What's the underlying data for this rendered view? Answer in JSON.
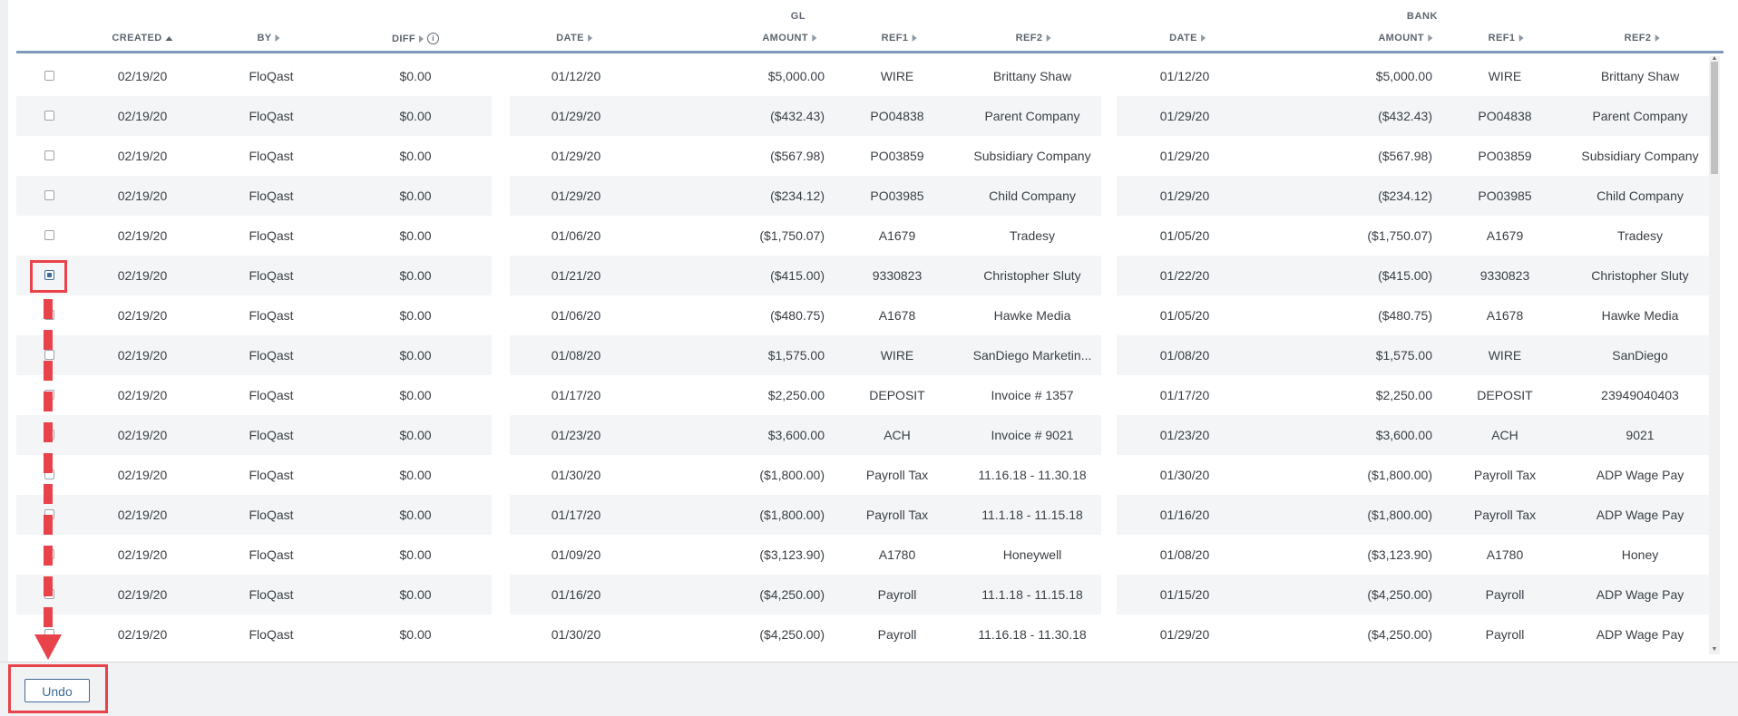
{
  "header": {
    "groups": {
      "gl": "GL",
      "bank": "BANK"
    },
    "columns": {
      "created": "CREATED",
      "by": "BY",
      "diff": "DIFF",
      "gl_date": "DATE",
      "gl_amount": "AMOUNT",
      "gl_ref1": "REF1",
      "gl_ref2": "REF2",
      "bank_date": "DATE",
      "bank_amount": "AMOUNT",
      "bank_ref1": "REF1",
      "bank_ref2": "REF2"
    },
    "sort": {
      "column": "created",
      "direction": "ascending"
    }
  },
  "rows": [
    {
      "checked": false,
      "created": "02/19/20",
      "by": "FloQast",
      "diff": "$0.00",
      "gl_date": "01/12/20",
      "gl_amount": "$5,000.00",
      "gl_ref1": "WIRE",
      "gl_ref2": "Brittany Shaw",
      "bank_date": "01/12/20",
      "bank_amount": "$5,000.00",
      "bank_ref1": "WIRE",
      "bank_ref2": "Brittany Shaw"
    },
    {
      "checked": false,
      "created": "02/19/20",
      "by": "FloQast",
      "diff": "$0.00",
      "gl_date": "01/29/20",
      "gl_amount": "($432.43)",
      "gl_ref1": "PO04838",
      "gl_ref2": "Parent Company",
      "bank_date": "01/29/20",
      "bank_amount": "($432.43)",
      "bank_ref1": "PO04838",
      "bank_ref2": "Parent Company"
    },
    {
      "checked": false,
      "created": "02/19/20",
      "by": "FloQast",
      "diff": "$0.00",
      "gl_date": "01/29/20",
      "gl_amount": "($567.98)",
      "gl_ref1": "PO03859",
      "gl_ref2": "Subsidiary Company",
      "bank_date": "01/29/20",
      "bank_amount": "($567.98)",
      "bank_ref1": "PO03859",
      "bank_ref2": "Subsidiary Company"
    },
    {
      "checked": false,
      "created": "02/19/20",
      "by": "FloQast",
      "diff": "$0.00",
      "gl_date": "01/29/20",
      "gl_amount": "($234.12)",
      "gl_ref1": "PO03985",
      "gl_ref2": "Child Company",
      "bank_date": "01/29/20",
      "bank_amount": "($234.12)",
      "bank_ref1": "PO03985",
      "bank_ref2": "Child Company"
    },
    {
      "checked": false,
      "created": "02/19/20",
      "by": "FloQast",
      "diff": "$0.00",
      "gl_date": "01/06/20",
      "gl_amount": "($1,750.07)",
      "gl_ref1": "A1679",
      "gl_ref2": "Tradesy",
      "bank_date": "01/05/20",
      "bank_amount": "($1,750.07)",
      "bank_ref1": "A1679",
      "bank_ref2": "Tradesy"
    },
    {
      "checked": true,
      "created": "02/19/20",
      "by": "FloQast",
      "diff": "$0.00",
      "gl_date": "01/21/20",
      "gl_amount": "($415.00)",
      "gl_ref1": "9330823",
      "gl_ref2": "Christopher Sluty",
      "bank_date": "01/22/20",
      "bank_amount": "($415.00)",
      "bank_ref1": "9330823",
      "bank_ref2": "Christopher Sluty"
    },
    {
      "checked": false,
      "created": "02/19/20",
      "by": "FloQast",
      "diff": "$0.00",
      "gl_date": "01/06/20",
      "gl_amount": "($480.75)",
      "gl_ref1": "A1678",
      "gl_ref2": "Hawke Media",
      "bank_date": "01/05/20",
      "bank_amount": "($480.75)",
      "bank_ref1": "A1678",
      "bank_ref2": "Hawke Media"
    },
    {
      "checked": false,
      "created": "02/19/20",
      "by": "FloQast",
      "diff": "$0.00",
      "gl_date": "01/08/20",
      "gl_amount": "$1,575.00",
      "gl_ref1": "WIRE",
      "gl_ref2": "SanDiego Marketin...",
      "bank_date": "01/08/20",
      "bank_amount": "$1,575.00",
      "bank_ref1": "WIRE",
      "bank_ref2": "SanDiego"
    },
    {
      "checked": false,
      "created": "02/19/20",
      "by": "FloQast",
      "diff": "$0.00",
      "gl_date": "01/17/20",
      "gl_amount": "$2,250.00",
      "gl_ref1": "DEPOSIT",
      "gl_ref2": "Invoice # 1357",
      "bank_date": "01/17/20",
      "bank_amount": "$2,250.00",
      "bank_ref1": "DEPOSIT",
      "bank_ref2": "23949040403"
    },
    {
      "checked": false,
      "created": "02/19/20",
      "by": "FloQast",
      "diff": "$0.00",
      "gl_date": "01/23/20",
      "gl_amount": "$3,600.00",
      "gl_ref1": "ACH",
      "gl_ref2": "Invoice # 9021",
      "bank_date": "01/23/20",
      "bank_amount": "$3,600.00",
      "bank_ref1": "ACH",
      "bank_ref2": "9021"
    },
    {
      "checked": false,
      "created": "02/19/20",
      "by": "FloQast",
      "diff": "$0.00",
      "gl_date": "01/30/20",
      "gl_amount": "($1,800.00)",
      "gl_ref1": "Payroll Tax",
      "gl_ref2": "11.16.18 - 11.30.18",
      "bank_date": "01/30/20",
      "bank_amount": "($1,800.00)",
      "bank_ref1": "Payroll Tax",
      "bank_ref2": "ADP Wage Pay"
    },
    {
      "checked": false,
      "created": "02/19/20",
      "by": "FloQast",
      "diff": "$0.00",
      "gl_date": "01/17/20",
      "gl_amount": "($1,800.00)",
      "gl_ref1": "Payroll Tax",
      "gl_ref2": "11.1.18 - 11.15.18",
      "bank_date": "01/16/20",
      "bank_amount": "($1,800.00)",
      "bank_ref1": "Payroll Tax",
      "bank_ref2": "ADP Wage Pay"
    },
    {
      "checked": false,
      "created": "02/19/20",
      "by": "FloQast",
      "diff": "$0.00",
      "gl_date": "01/09/20",
      "gl_amount": "($3,123.90)",
      "gl_ref1": "A1780",
      "gl_ref2": "Honeywell",
      "bank_date": "01/08/20",
      "bank_amount": "($3,123.90)",
      "bank_ref1": "A1780",
      "bank_ref2": "Honey"
    },
    {
      "checked": false,
      "created": "02/19/20",
      "by": "FloQast",
      "diff": "$0.00",
      "gl_date": "01/16/20",
      "gl_amount": "($4,250.00)",
      "gl_ref1": "Payroll",
      "gl_ref2": "11.1.18 - 11.15.18",
      "bank_date": "01/15/20",
      "bank_amount": "($4,250.00)",
      "bank_ref1": "Payroll",
      "bank_ref2": "ADP Wage Pay"
    },
    {
      "checked": false,
      "created": "02/19/20",
      "by": "FloQast",
      "diff": "$0.00",
      "gl_date": "01/30/20",
      "gl_amount": "($4,250.00)",
      "gl_ref1": "Payroll",
      "gl_ref2": "11.16.18 - 11.30.18",
      "bank_date": "01/29/20",
      "bank_amount": "($4,250.00)",
      "bank_ref1": "Payroll",
      "bank_ref2": "ADP Wage Pay"
    }
  ],
  "footer": {
    "undo_label": "Undo"
  },
  "annotation": {
    "color": "#e8434a"
  },
  "colors": {
    "accent": "#3e6a95",
    "header_rule": "#7d9bb9",
    "band": "#f3f5f7"
  }
}
